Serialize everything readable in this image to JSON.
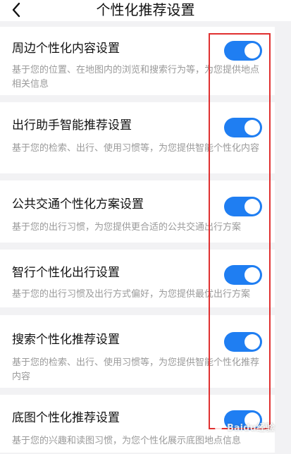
{
  "header": {
    "back_icon": "chevron-left-icon",
    "title": "个性化推荐设置"
  },
  "settings": [
    {
      "title": "周边个性化内容设置",
      "desc": "基于您的位置、在地图内的浏览和搜索行为等，为您提供地点相关信息",
      "enabled": true
    },
    {
      "title": "出行助手智能推荐设置",
      "desc": "基于您的检索、出行、使用习惯等，为您提供智能个性化内容",
      "enabled": true
    },
    {
      "title": "公共交通个性化方案设置",
      "desc": "基于您的出行习惯，为您提供更合适的公共交通出行方案",
      "enabled": true
    },
    {
      "title": "智行个性化出行设置",
      "desc": "基于您的出行习惯及出行方式偏好，为您提供最优出行方案",
      "enabled": true
    },
    {
      "title": "搜索个性化推荐设置",
      "desc": "基于您的检索、出行、使用习惯等，为您提供智能个性化推荐内容",
      "enabled": true
    },
    {
      "title": "底图个性化推荐设置",
      "desc": "基于您的兴趣和读图习惯，为您个性化展示底图地点信息",
      "enabled": true
    }
  ],
  "colors": {
    "toggle_on": "#1f7ef2",
    "highlight": "#e03030",
    "background": "#f2f2f4"
  },
  "watermark": {
    "text": "Baidu经验"
  }
}
